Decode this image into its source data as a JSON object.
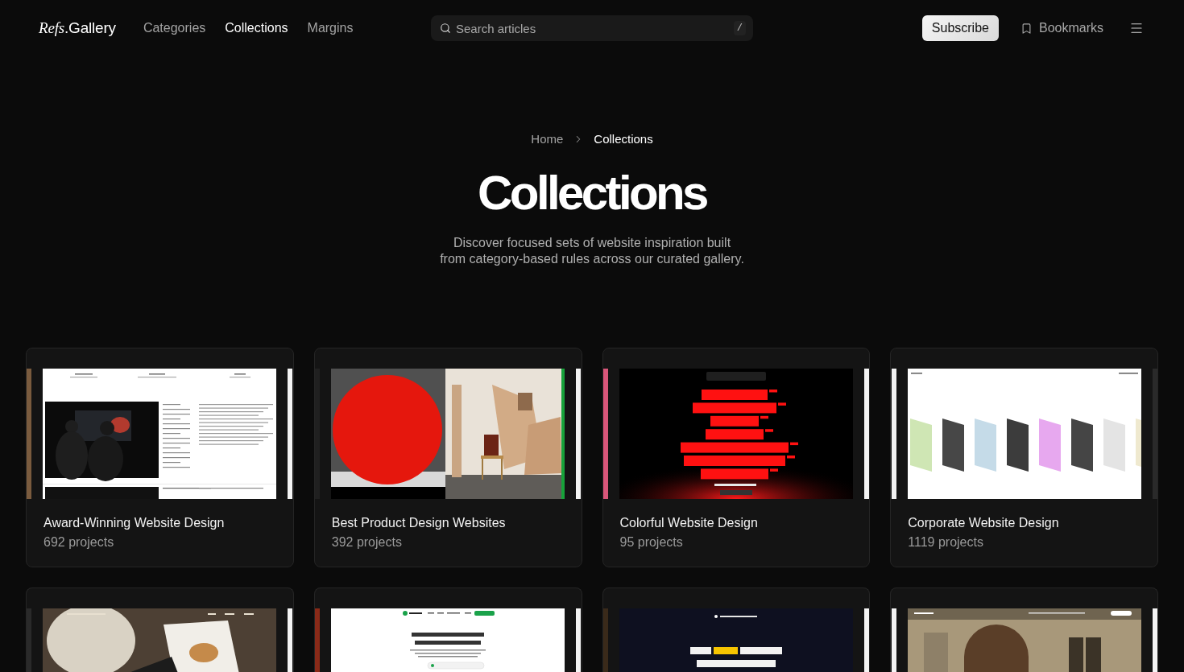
{
  "header": {
    "logo": "*Refs*.Gallery",
    "nav": [
      {
        "label": "Categories",
        "selected": false
      },
      {
        "label": "Collections",
        "selected": true
      },
      {
        "label": "Margins",
        "selected": false
      }
    ],
    "search": {
      "placeholder": "Search articles",
      "shortcut": "/"
    },
    "subscribe_button": "Subscribe",
    "bookmarks_link": "Bookmarks"
  },
  "breadcrumb": [
    {
      "label": "Home",
      "selected": false
    },
    {
      "label": "Collections",
      "selected": true
    }
  ],
  "title": "Collections",
  "description": "Discover focused sets of website inspiration built from category-based rules across our curated gallery.",
  "collections": [
    {
      "kind": "portfolio",
      "title": "Award-Winning Website Design",
      "count": "692 projects"
    },
    {
      "kind": "product",
      "title": "Best Product Design Websites",
      "count": "392 projects"
    },
    {
      "kind": "poster",
      "title": "Colorful Website Design",
      "count": "95 projects"
    },
    {
      "kind": "gallery",
      "title": "Corporate Website Design",
      "count": "1119 projects"
    },
    {
      "kind": "magazine"
    },
    {
      "kind": "network"
    },
    {
      "kind": "dark-landing"
    },
    {
      "kind": "building"
    }
  ]
}
